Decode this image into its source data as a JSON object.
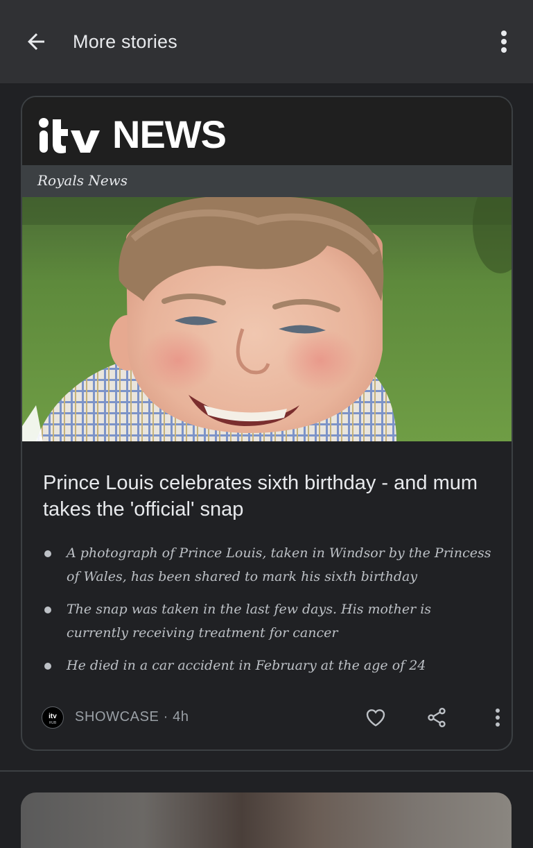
{
  "app_bar": {
    "title": "More stories"
  },
  "icons": {
    "back": "arrow-back-icon",
    "overflow": "more-vert-icon",
    "like": "heart-icon",
    "share": "share-icon",
    "card_overflow": "more-vert-icon"
  },
  "card": {
    "brand_logo_text": "itv",
    "brand_name": "NEWS",
    "section": "Royals News",
    "headline": "Prince Louis celebrates sixth birthday - and mum takes the 'official' snap",
    "bullets": [
      "A photograph of Prince Louis, taken in Windsor by the Princess of Wales, has been shared to mark his sixth birthday",
      "The snap was taken in the last few days. His mother is currently receiving treatment for cancer",
      "He died in a car accident in February at the age of 24"
    ],
    "source_avatar_text": "itv",
    "source_avatar_sub": "HUB",
    "source": "SHOWCASE",
    "meta_separator": "·",
    "age": "4h"
  },
  "colors": {
    "background": "#202124",
    "app_bar": "#303134",
    "card_border": "#3c4043",
    "section_band": "#3c4043",
    "text_primary": "#e8eaed",
    "text_secondary": "#bdc1c6",
    "text_muted": "#9aa0a6"
  }
}
